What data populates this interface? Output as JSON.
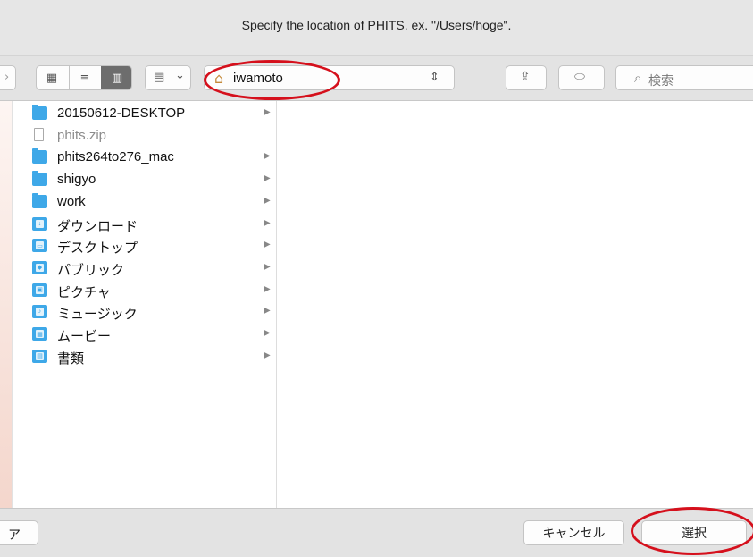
{
  "window": {
    "title": "Specify the location of PHITS. ex. \"/Users/hoge\"."
  },
  "toolbar": {
    "back_glyph": "›",
    "view_icon": "▦",
    "list_icon": "≡",
    "column_icon": "▥",
    "group_icon": "▤",
    "group_chevron": "⌄",
    "location_icon": "⌂",
    "location": "iwamoto",
    "location_updown": "⇕",
    "share_icon": "⇪",
    "tag_icon": "⬭",
    "search_icon": "⌕",
    "search_placeholder": "検索"
  },
  "browser": {
    "items": [
      {
        "label": "20150612-DESKTOP",
        "kind": "folder",
        "dim": false,
        "chevron": "▶",
        "glyph": ""
      },
      {
        "label": "phits.zip",
        "kind": "file",
        "dim": true,
        "chevron": "",
        "glyph": ""
      },
      {
        "label": "phits264to276_mac",
        "kind": "folder",
        "dim": false,
        "chevron": "▶",
        "glyph": ""
      },
      {
        "label": "shigyo",
        "kind": "folder",
        "dim": false,
        "chevron": "▶",
        "glyph": ""
      },
      {
        "label": "work",
        "kind": "folder",
        "dim": false,
        "chevron": "▶",
        "glyph": ""
      },
      {
        "label": "ダウンロード",
        "kind": "special",
        "dim": false,
        "chevron": "▶",
        "glyph": "↓"
      },
      {
        "label": "デスクトップ",
        "kind": "special",
        "dim": false,
        "chevron": "▶",
        "glyph": "▭"
      },
      {
        "label": "パブリック",
        "kind": "special",
        "dim": false,
        "chevron": "▶",
        "glyph": "◆"
      },
      {
        "label": "ピクチャ",
        "kind": "special",
        "dim": false,
        "chevron": "▶",
        "glyph": "▣"
      },
      {
        "label": "ミュージック",
        "kind": "special",
        "dim": false,
        "chevron": "▶",
        "glyph": "♪"
      },
      {
        "label": "ムービー",
        "kind": "special",
        "dim": false,
        "chevron": "▶",
        "glyph": "▦"
      },
      {
        "label": "書類",
        "kind": "special",
        "dim": false,
        "chevron": "▶",
        "glyph": "▤"
      }
    ]
  },
  "footer": {
    "left_button": "ア",
    "cancel": "キャンセル",
    "choose": "選択"
  },
  "colors": {
    "folder_blue": "#3ea8e8",
    "annotation_red": "#d5101c"
  }
}
